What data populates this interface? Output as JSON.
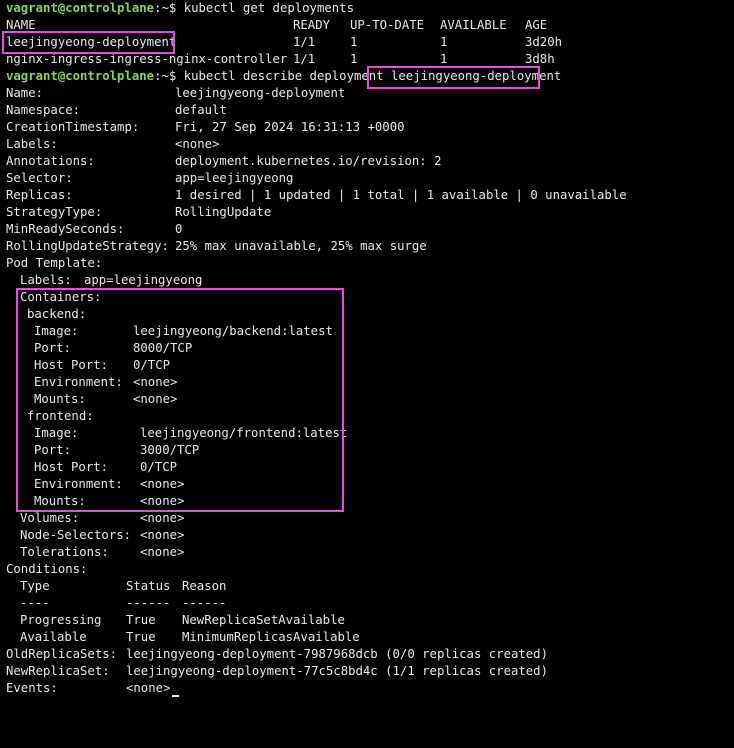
{
  "prompt": {
    "user_host": "vagrant@controlplane",
    "sep": ":~$ "
  },
  "cmd1": "kubectl get deployments",
  "get_table": {
    "headers": [
      "NAME",
      "READY",
      "UP-TO-DATE",
      "AVAILABLE",
      "AGE"
    ],
    "rows": [
      [
        "leejingyeong-deployment",
        "1/1",
        "1",
        "1",
        "3d20h"
      ],
      [
        "nginx-ingress-ingress-nginx-controller",
        "1/1",
        "1",
        "1",
        "3d8h"
      ]
    ]
  },
  "cmd2": {
    "prefix": "kubectl describe deployment ",
    "target": "leejingyeong-deployment"
  },
  "describe": {
    "name": [
      "Name:",
      "leejingyeong-deployment"
    ],
    "namespace": [
      "Namespace:",
      "default"
    ],
    "creation": [
      "CreationTimestamp:",
      "Fri, 27 Sep 2024 16:31:13 +0000"
    ],
    "labels": [
      "Labels:",
      "<none>"
    ],
    "annotations": [
      "Annotations:",
      "deployment.kubernetes.io/revision: 2"
    ],
    "selector": [
      "Selector:",
      "app=leejingyeong"
    ],
    "replicas": [
      "Replicas:",
      "1 desired | 1 updated | 1 total | 1 available | 0 unavailable"
    ],
    "strategy": [
      "StrategyType:",
      "RollingUpdate"
    ],
    "minready": [
      "MinReadySeconds:",
      "0"
    ],
    "rolling": [
      "RollingUpdateStrategy:",
      "25% max unavailable, 25% max surge"
    ],
    "pod_template": "Pod Template:",
    "pod_labels": [
      "Labels:",
      "app=leejingyeong"
    ],
    "containers_label": "Containers:",
    "backend": {
      "name": "backend:",
      "image": [
        "Image:",
        "leejingyeong/backend:latest"
      ],
      "port": [
        "Port:",
        "8000/TCP"
      ],
      "host_port": [
        "Host Port:",
        "0/TCP"
      ],
      "env": [
        "Environment:",
        "<none>"
      ],
      "mounts": [
        "Mounts:",
        "<none>"
      ]
    },
    "frontend": {
      "name": "frontend:",
      "image": [
        "Image:",
        "leejingyeong/frontend:latest"
      ],
      "port": [
        "Port:",
        "3000/TCP"
      ],
      "host_port": [
        "Host Port:",
        "0/TCP"
      ],
      "env": [
        "Environment:",
        "<none>"
      ],
      "mounts": [
        "Mounts:",
        "<none>"
      ]
    },
    "volumes": [
      "Volumes:",
      "<none>"
    ],
    "node_selectors": [
      "Node-Selectors:",
      "<none>"
    ],
    "tolerations": [
      "Tolerations:",
      "<none>"
    ],
    "conditions_label": "Conditions:",
    "conditions_headers": [
      "Type",
      "Status",
      "Reason"
    ],
    "conditions_sep": [
      "----",
      "------",
      "------"
    ],
    "conditions": [
      [
        "Progressing",
        "True",
        "NewReplicaSetAvailable"
      ],
      [
        "Available",
        "True",
        "MinimumReplicasAvailable"
      ]
    ],
    "old_rs": [
      "OldReplicaSets:",
      "leejingyeong-deployment-7987968dcb (0/0 replicas created)"
    ],
    "new_rs": [
      "NewReplicaSet:",
      "leejingyeong-deployment-77c5c8bd4c (1/1 replicas created)"
    ],
    "events": [
      "Events:",
      "<none>"
    ]
  },
  "highlight_color": "#e54ce0"
}
